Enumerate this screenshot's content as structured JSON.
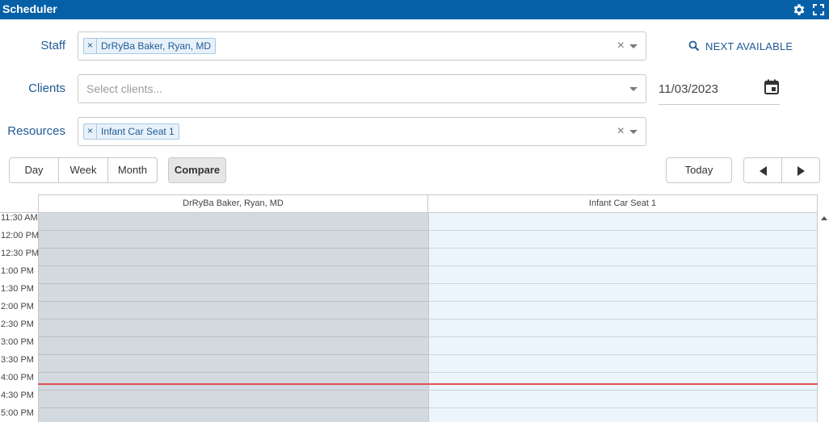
{
  "app": {
    "title": "Scheduler"
  },
  "icons": {
    "settings": "gear-icon",
    "maximize": "expand-icon",
    "search": "search-icon",
    "calendar": "calendar-icon"
  },
  "staff": {
    "label": "Staff",
    "selected": [
      "DrRyBa Baker, Ryan, MD"
    ]
  },
  "clients": {
    "label": "Clients",
    "placeholder": "Select clients..."
  },
  "resources": {
    "label": "Resources",
    "selected": [
      "Infant Car Seat 1"
    ]
  },
  "chip_remove": "×",
  "clear_symbol": "×",
  "next_available": {
    "label": "NEXT AVAILABLE"
  },
  "date": {
    "value": "11/03/2023"
  },
  "views": {
    "day": "Day",
    "week": "Week",
    "month": "Month",
    "compare": "Compare",
    "active": "Compare"
  },
  "nav": {
    "today": "Today"
  },
  "calendar": {
    "columns": [
      "DrRyBa Baker, Ryan, MD",
      "Infant Car Seat 1"
    ],
    "times": [
      "11:30 AM",
      "12:00 PM",
      "12:30 PM",
      "1:00 PM",
      "1:30 PM",
      "2:00 PM",
      "2:30 PM",
      "3:00 PM",
      "3:30 PM",
      "4:00 PM",
      "4:30 PM",
      "5:00 PM"
    ]
  },
  "colors": {
    "titlebar": "#0560a8",
    "label": "#1e5a96",
    "staff_column": "#d2d9df",
    "resource_column": "#ecf4fc",
    "current_time": "#e05050"
  }
}
